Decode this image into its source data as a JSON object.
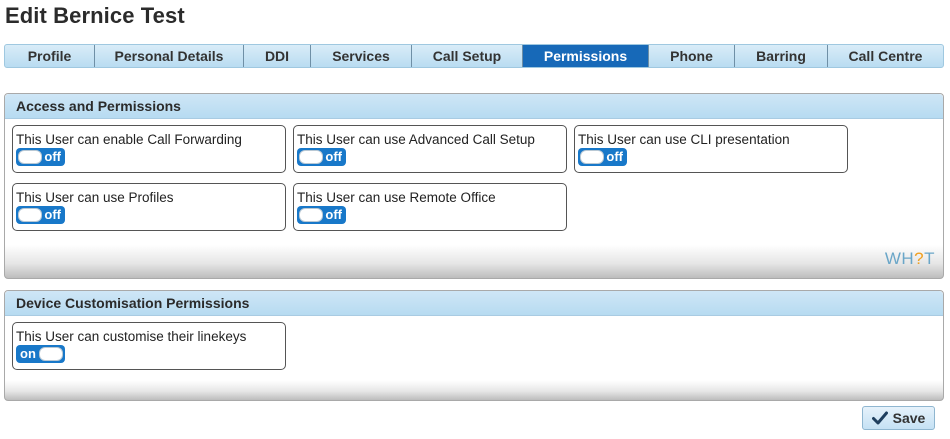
{
  "page": {
    "title": "Edit Bernice Test"
  },
  "tabs": [
    {
      "label": "Profile",
      "active": false
    },
    {
      "label": "Personal Details",
      "active": false
    },
    {
      "label": "DDI",
      "active": false
    },
    {
      "label": "Services",
      "active": false
    },
    {
      "label": "Call Setup",
      "active": false
    },
    {
      "label": "Permissions",
      "active": true
    },
    {
      "label": "Phone",
      "active": false
    },
    {
      "label": "Barring",
      "active": false
    },
    {
      "label": "Call Centre",
      "active": false
    }
  ],
  "access_panel": {
    "title": "Access and Permissions",
    "items": [
      {
        "label": "This User can enable Call Forwarding",
        "state": "off"
      },
      {
        "label": "This User can use Advanced Call Setup",
        "state": "off"
      },
      {
        "label": "This User can use CLI presentation",
        "state": "off"
      },
      {
        "label": "This User can use Profiles",
        "state": "off"
      },
      {
        "label": "This User can use Remote Office",
        "state": "off"
      }
    ],
    "brand": {
      "pre": "WH",
      "mark": "?",
      "post": "T"
    }
  },
  "device_panel": {
    "title": "Device Customisation Permissions",
    "items": [
      {
        "label": "This User can customise their linekeys",
        "state": "on"
      }
    ]
  },
  "footer": {
    "save_label": "Save"
  },
  "colors": {
    "accent": "#1769b8",
    "toggle": "#1878c9",
    "tab_bg": "#c6e3f5"
  },
  "icons": {
    "save": "check-icon"
  }
}
